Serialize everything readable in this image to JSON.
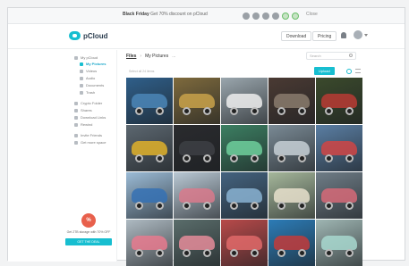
{
  "promo_bar": {
    "brand": "Black Friday",
    "text": "Get 70% discount on pCloud",
    "link": "Close"
  },
  "header": {
    "logo": "pCloud",
    "download_label": "Download",
    "pricing_label": "Pricing"
  },
  "sidebar": {
    "items": [
      {
        "label": "My pCloud",
        "active": false
      },
      {
        "label": "My Pictures",
        "active": true
      },
      {
        "label": "Videos",
        "active": false
      },
      {
        "label": "Audio",
        "active": false
      },
      {
        "label": "Documents",
        "active": false
      },
      {
        "label": "Trash",
        "active": false
      },
      {
        "label": "Crypto Folder",
        "active": false
      },
      {
        "label": "Shares",
        "active": false
      },
      {
        "label": "Download Links",
        "active": false
      },
      {
        "label": "Rewind",
        "active": false
      },
      {
        "label": "Invite Friends",
        "active": false
      },
      {
        "label": "Get more space",
        "active": false
      }
    ],
    "promo": {
      "badge": "%",
      "caption": "Get 2TB storage with 70% OFF",
      "cta": "GET THE DEAL"
    }
  },
  "main": {
    "breadcrumb": {
      "root": "Files",
      "current": "My Pictures",
      "more": "..."
    },
    "search_placeholder": "Search",
    "selection_text": "Select all 24 items",
    "upload_label": "Upload",
    "photos": [
      {
        "bg": "#2f5f8a",
        "car": "#4b86b7"
      },
      {
        "bg": "#7e6a3d",
        "car": "#c9a24a"
      },
      {
        "bg": "#9aa6ad",
        "car": "#efefef"
      },
      {
        "bg": "#4a3a33",
        "car": "#8a7b6d"
      },
      {
        "bg": "#3b4a2c",
        "car": "#b93b34"
      },
      {
        "bg": "#5c6770",
        "car": "#e0b12a"
      },
      {
        "bg": "#2a2b2e",
        "car": "#3d3f44"
      },
      {
        "bg": "#3c7f62",
        "car": "#6ecf9c"
      },
      {
        "bg": "#7a8a95",
        "car": "#c7d0d6"
      },
      {
        "bg": "#5a7ea3",
        "car": "#d04545"
      },
      {
        "bg": "#9bbbd6",
        "car": "#3571b4"
      },
      {
        "bg": "#b9c8d4",
        "car": "#d97a8c"
      },
      {
        "bg": "#44637f",
        "car": "#8ab3d2"
      },
      {
        "bg": "#a5b79b",
        "car": "#e8e1cc"
      },
      {
        "bg": "#6f7d87",
        "car": "#d66a78"
      },
      {
        "bg": "#aebac2",
        "car": "#e87a8e"
      },
      {
        "bg": "#5a6d6b",
        "car": "#e58c9a"
      },
      {
        "bg": "#b84a4a",
        "car": "#e06a6a"
      },
      {
        "bg": "#2c7cb7",
        "car": "#c23b3b"
      },
      {
        "bg": "#9fb6b3",
        "car": "#a8d8cf"
      }
    ]
  },
  "colors": {
    "accent": "#17bed0",
    "promo_badge": "#e8604c"
  }
}
